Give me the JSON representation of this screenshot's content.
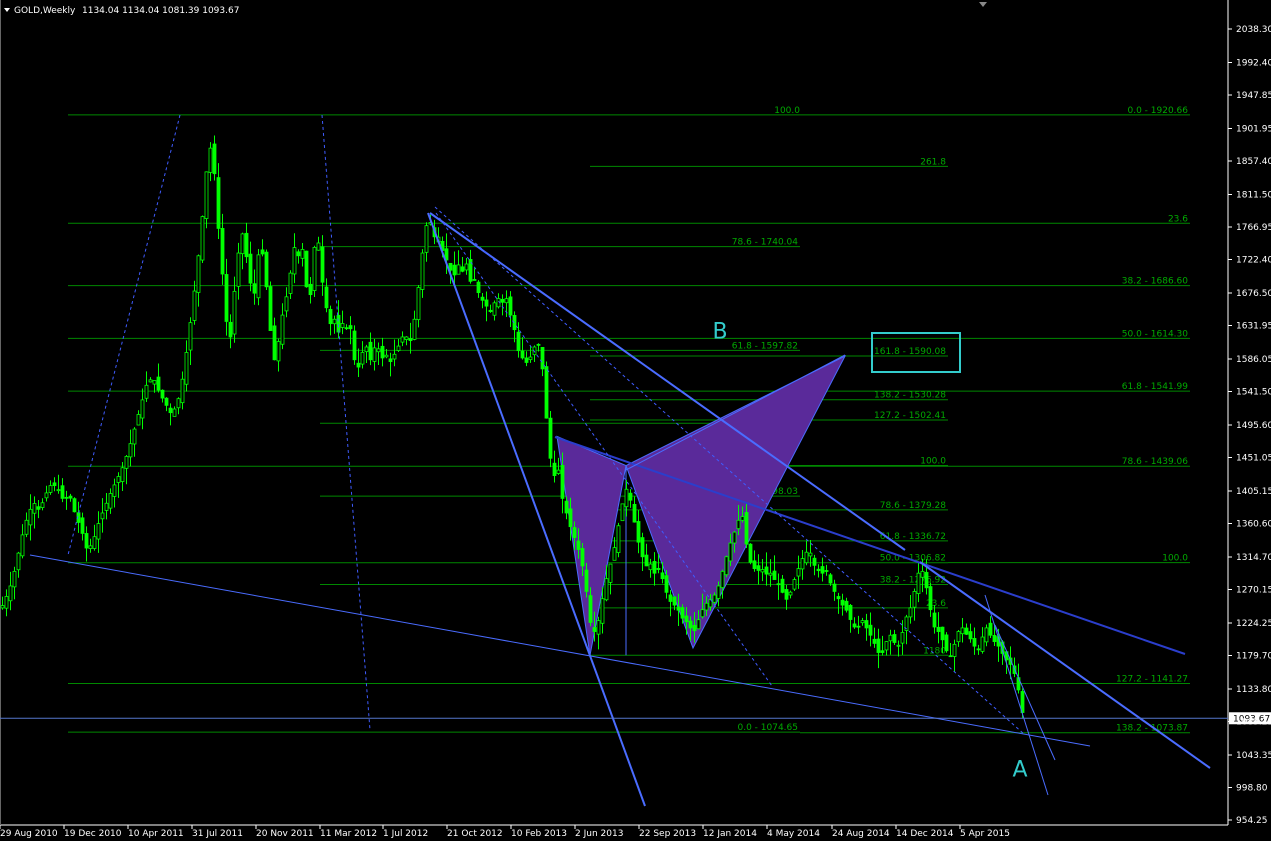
{
  "header": {
    "symbol": "GOLD,Weekly",
    "ohlc": "1134.04 1134.04 1081.39 1093.67"
  },
  "colors": {
    "background": "#000000",
    "candle": "#00ff00",
    "fib": "#008800",
    "fib_text": "#00aa00",
    "trendline": "#4a6cff",
    "pattern_fill": "#5a2a9a",
    "highlight": "#33cccc",
    "price_line": "#5577cc"
  },
  "chart_data": {
    "type": "candlestick",
    "title": "GOLD,Weekly",
    "ylim": [
      954.25,
      2083.5
    ],
    "y_ticks": [
      "2038.30",
      "1992.40",
      "1947.85",
      "1901.95",
      "1857.40",
      "1811.50",
      "1766.95",
      "1722.40",
      "1676.50",
      "1631.95",
      "1586.05",
      "1541.50",
      "1495.60",
      "1451.05",
      "1405.15",
      "1360.60",
      "1314.70",
      "1270.15",
      "1224.25",
      "1179.70",
      "1133.80",
      "1089.25",
      "1043.35",
      "998.80",
      "954.25"
    ],
    "x_ticks": [
      "29 Aug 2010",
      "19 Dec 2010",
      "10 Apr 2011",
      "31 Jul 2011",
      "20 Nov 2011",
      "11 Mar 2012",
      "1 Jul 2012",
      "21 Oct 2012",
      "10 Feb 2013",
      "2 Jun 2013",
      "22 Sep 2013",
      "12 Jan 2014",
      "4 May 2014",
      "24 Aug 2014",
      "14 Dec 2014",
      "5 Apr 2015"
    ],
    "current_price": "1093.67",
    "price_path": [
      [
        0,
        1245
      ],
      [
        8,
        1270
      ],
      [
        14,
        1300
      ],
      [
        20,
        1340
      ],
      [
        26,
        1370
      ],
      [
        32,
        1390
      ],
      [
        38,
        1378
      ],
      [
        44,
        1400
      ],
      [
        50,
        1415
      ],
      [
        56,
        1410
      ],
      [
        62,
        1392
      ],
      [
        68,
        1400
      ],
      [
        74,
        1372
      ],
      [
        80,
        1352
      ],
      [
        86,
        1322
      ],
      [
        92,
        1338
      ],
      [
        98,
        1365
      ],
      [
        104,
        1385
      ],
      [
        110,
        1405
      ],
      [
        116,
        1422
      ],
      [
        122,
        1440
      ],
      [
        128,
        1465
      ],
      [
        134,
        1495
      ],
      [
        140,
        1525
      ],
      [
        146,
        1555
      ],
      [
        152,
        1560
      ],
      [
        158,
        1540
      ],
      [
        164,
        1525
      ],
      [
        170,
        1510
      ],
      [
        176,
        1525
      ],
      [
        182,
        1565
      ],
      [
        188,
        1625
      ],
      [
        194,
        1690
      ],
      [
        200,
        1765
      ],
      [
        204,
        1830
      ],
      [
        208,
        1880
      ],
      [
        212,
        1860
      ],
      [
        216,
        1780
      ],
      [
        220,
        1720
      ],
      [
        224,
        1650
      ],
      [
        228,
        1600
      ],
      [
        232,
        1665
      ],
      [
        236,
        1720
      ],
      [
        240,
        1765
      ],
      [
        244,
        1735
      ],
      [
        248,
        1700
      ],
      [
        252,
        1660
      ],
      [
        256,
        1725
      ],
      [
        260,
        1740
      ],
      [
        264,
        1700
      ],
      [
        268,
        1640
      ],
      [
        272,
        1580
      ],
      [
        276,
        1600
      ],
      [
        280,
        1640
      ],
      [
        284,
        1665
      ],
      [
        288,
        1690
      ],
      [
        292,
        1745
      ],
      [
        296,
        1720
      ],
      [
        300,
        1750
      ],
      [
        304,
        1695
      ],
      [
        308,
        1655
      ],
      [
        312,
        1732
      ],
      [
        316,
        1760
      ],
      [
        320,
        1700
      ],
      [
        324,
        1665
      ],
      [
        328,
        1630
      ],
      [
        332,
        1648
      ],
      [
        336,
        1618
      ],
      [
        340,
        1638
      ],
      [
        344,
        1625
      ],
      [
        348,
        1640
      ],
      [
        352,
        1590
      ],
      [
        356,
        1570
      ],
      [
        360,
        1590
      ],
      [
        364,
        1610
      ],
      [
        368,
        1580
      ],
      [
        372,
        1600
      ],
      [
        376,
        1605
      ],
      [
        380,
        1585
      ],
      [
        384,
        1595
      ],
      [
        388,
        1580
      ],
      [
        392,
        1590
      ],
      [
        396,
        1600
      ],
      [
        400,
        1615
      ],
      [
        404,
        1620
      ],
      [
        408,
        1605
      ],
      [
        412,
        1630
      ],
      [
        416,
        1672
      ],
      [
        420,
        1720
      ],
      [
        424,
        1765
      ],
      [
        428,
        1780
      ],
      [
        432,
        1752
      ],
      [
        436,
        1758
      ],
      [
        440,
        1738
      ],
      [
        444,
        1725
      ],
      [
        448,
        1712
      ],
      [
        452,
        1695
      ],
      [
        456,
        1720
      ],
      [
        460,
        1700
      ],
      [
        464,
        1725
      ],
      [
        468,
        1690
      ],
      [
        472,
        1700
      ],
      [
        476,
        1680
      ],
      [
        480,
        1668
      ],
      [
        484,
        1662
      ],
      [
        488,
        1648
      ],
      [
        492,
        1660
      ],
      [
        496,
        1672
      ],
      [
        500,
        1660
      ],
      [
        504,
        1675
      ],
      [
        508,
        1650
      ],
      [
        512,
        1635
      ],
      [
        516,
        1600
      ],
      [
        520,
        1590
      ],
      [
        524,
        1580
      ],
      [
        528,
        1585
      ],
      [
        532,
        1600
      ],
      [
        536,
        1610
      ],
      [
        540,
        1590
      ],
      [
        544,
        1520
      ],
      [
        548,
        1460
      ],
      [
        552,
        1420
      ],
      [
        556,
        1445
      ],
      [
        560,
        1400
      ],
      [
        564,
        1380
      ],
      [
        568,
        1360
      ],
      [
        572,
        1345
      ],
      [
        576,
        1330
      ],
      [
        580,
        1310
      ],
      [
        584,
        1280
      ],
      [
        588,
        1230
      ],
      [
        592,
        1210
      ],
      [
        596,
        1220
      ],
      [
        600,
        1250
      ],
      [
        604,
        1280
      ],
      [
        608,
        1300
      ],
      [
        612,
        1320
      ],
      [
        616,
        1350
      ],
      [
        620,
        1380
      ],
      [
        624,
        1410
      ],
      [
        628,
        1400
      ],
      [
        632,
        1370
      ],
      [
        636,
        1340
      ],
      [
        640,
        1320
      ],
      [
        644,
        1300
      ],
      [
        648,
        1310
      ],
      [
        652,
        1290
      ],
      [
        656,
        1300
      ],
      [
        660,
        1290
      ],
      [
        664,
        1270
      ],
      [
        668,
        1255
      ],
      [
        672,
        1250
      ],
      [
        676,
        1245
      ],
      [
        680,
        1232
      ],
      [
        684,
        1228
      ],
      [
        688,
        1220
      ],
      [
        692,
        1210
      ],
      [
        696,
        1225
      ],
      [
        700,
        1240
      ],
      [
        704,
        1250
      ],
      [
        708,
        1255
      ],
      [
        712,
        1260
      ],
      [
        716,
        1270
      ],
      [
        720,
        1290
      ],
      [
        724,
        1310
      ],
      [
        728,
        1330
      ],
      [
        732,
        1345
      ],
      [
        736,
        1360
      ],
      [
        740,
        1380
      ],
      [
        744,
        1340
      ],
      [
        748,
        1310
      ],
      [
        752,
        1300
      ],
      [
        756,
        1295
      ],
      [
        760,
        1300
      ],
      [
        764,
        1290
      ],
      [
        768,
        1295
      ],
      [
        772,
        1285
      ],
      [
        776,
        1280
      ],
      [
        780,
        1270
      ],
      [
        784,
        1255
      ],
      [
        788,
        1262
      ],
      [
        792,
        1280
      ],
      [
        796,
        1295
      ],
      [
        800,
        1310
      ],
      [
        804,
        1320
      ],
      [
        808,
        1325
      ],
      [
        812,
        1305
      ],
      [
        816,
        1298
      ],
      [
        820,
        1290
      ],
      [
        824,
        1300
      ],
      [
        828,
        1282
      ],
      [
        832,
        1270
      ],
      [
        836,
        1260
      ],
      [
        840,
        1250
      ],
      [
        844,
        1245
      ],
      [
        848,
        1232
      ],
      [
        852,
        1220
      ],
      [
        856,
        1215
      ],
      [
        860,
        1230
      ],
      [
        864,
        1220
      ],
      [
        868,
        1210
      ],
      [
        872,
        1200
      ],
      [
        876,
        1185
      ],
      [
        880,
        1180
      ],
      [
        884,
        1195
      ],
      [
        888,
        1210
      ],
      [
        892,
        1200
      ],
      [
        896,
        1190
      ],
      [
        900,
        1205
      ],
      [
        904,
        1230
      ],
      [
        908,
        1240
      ],
      [
        912,
        1260
      ],
      [
        916,
        1290
      ],
      [
        920,
        1300
      ],
      [
        924,
        1280
      ],
      [
        928,
        1250
      ],
      [
        932,
        1220
      ],
      [
        936,
        1215
      ],
      [
        940,
        1205
      ],
      [
        944,
        1190
      ],
      [
        948,
        1175
      ],
      [
        952,
        1190
      ],
      [
        956,
        1210
      ],
      [
        960,
        1220
      ],
      [
        964,
        1210
      ],
      [
        968,
        1205
      ],
      [
        972,
        1195
      ],
      [
        976,
        1185
      ],
      [
        980,
        1200
      ],
      [
        984,
        1220
      ],
      [
        988,
        1210
      ],
      [
        992,
        1200
      ],
      [
        996,
        1195
      ],
      [
        1000,
        1185
      ],
      [
        1004,
        1175
      ],
      [
        1008,
        1170
      ],
      [
        1012,
        1160
      ],
      [
        1016,
        1140
      ],
      [
        1020,
        1110
      ],
      [
        1022,
        1093
      ]
    ],
    "fibonacci_levels": [
      {
        "y": 1920.66,
        "x1": 68,
        "x2": 1190,
        "left": "100.0",
        "right": "0.0 - 1920.66"
      },
      {
        "y": 1850,
        "x1": 590,
        "x2": 948,
        "left": "",
        "right": "261.8"
      },
      {
        "y": 1772,
        "x1": 68,
        "x2": 1190,
        "left": "",
        "right": "23.6"
      },
      {
        "y": 1740.04,
        "x1": 320,
        "x2": 800,
        "left": "",
        "right": "78.6 - 1740.04"
      },
      {
        "y": 1686.6,
        "x1": 68,
        "x2": 1190,
        "left": "",
        "right": "38.2 - 1686.60"
      },
      {
        "y": 1614.3,
        "x1": 68,
        "x2": 1190,
        "left": "",
        "right": "50.0 - 1614.30"
      },
      {
        "y": 1597.82,
        "x1": 320,
        "x2": 800,
        "left": "",
        "right": "61.8 - 1597.82"
      },
      {
        "y": 1590.08,
        "x1": 590,
        "x2": 948,
        "left": "",
        "right": "161.8 - 1590.08"
      },
      {
        "y": 1541.99,
        "x1": 68,
        "x2": 1190,
        "left": "",
        "right": "61.8 - 1541.99"
      },
      {
        "y": 1530.28,
        "x1": 590,
        "x2": 948,
        "left": "",
        "right": "138.2 - 1530.28"
      },
      {
        "y": 1502.41,
        "x1": 590,
        "x2": 948,
        "left": "",
        "right": "127.2 - 1502.41"
      },
      {
        "y": 1497.92,
        "x1": 320,
        "x2": 800,
        "left": "",
        "right": "50.0 - 1497.92"
      },
      {
        "y": 1439.06,
        "x1": 68,
        "x2": 1190,
        "left": "",
        "right": "78.6 - 1439.06"
      },
      {
        "y": 1440,
        "x1": 590,
        "x2": 948,
        "left": "",
        "right": "100.0"
      },
      {
        "y": 1398.03,
        "x1": 320,
        "x2": 800,
        "left": "",
        "right": "38.2 - 1398.03"
      },
      {
        "y": 1379.28,
        "x1": 590,
        "x2": 948,
        "left": "",
        "right": "78.6 - 1379.28"
      },
      {
        "y": 1336.72,
        "x1": 590,
        "x2": 948,
        "left": "",
        "right": "61.8 - 1336.72"
      },
      {
        "y": 1306.82,
        "x1": 68,
        "x2": 948,
        "left": "",
        "right": "50.0 - 1306.82"
      },
      {
        "y": 1307,
        "x1": 948,
        "x2": 1190,
        "left": "",
        "right": "100.0"
      },
      {
        "y": 1276.92,
        "x1": 320,
        "x2": 948,
        "left": "",
        "right": "38.2 - 1276.92"
      },
      {
        "y": 1245,
        "x1": 590,
        "x2": 948,
        "left": "",
        "right": "23.6"
      },
      {
        "y": 1180,
        "x1": 590,
        "x2": 948,
        "left": "",
        "right": "1180"
      },
      {
        "y": 1141.27,
        "x1": 68,
        "x2": 1190,
        "left": "",
        "right": "127.2 - 1141.27"
      },
      {
        "y": 1074.65,
        "x1": 68,
        "x2": 800,
        "left": "",
        "right": "0.0 - 1074.65"
      },
      {
        "y": 1073.87,
        "x1": 800,
        "x2": 1190,
        "left": "",
        "right": "138.2 - 1073.87"
      }
    ],
    "annotations": [
      {
        "text": "B",
        "x": 720,
        "y": 1625
      },
      {
        "text": "A",
        "x": 1020,
        "y": 1025
      }
    ],
    "highlight_box_label": "161.8 - 1590.08"
  }
}
